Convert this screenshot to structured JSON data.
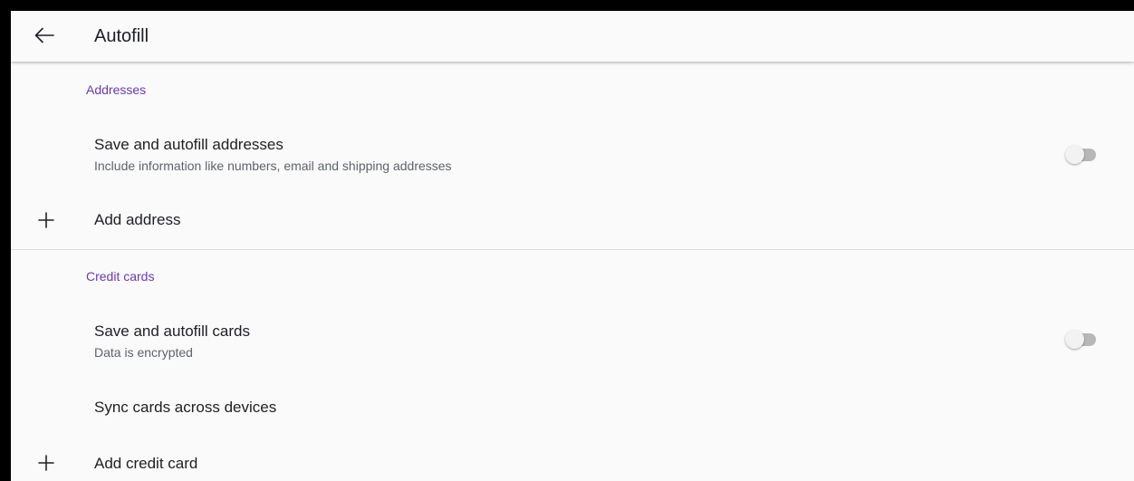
{
  "appbar": {
    "title": "Autofill",
    "back_icon": "arrow-left-icon"
  },
  "addresses": {
    "header": "Addresses",
    "save_title": "Save and autofill addresses",
    "save_subtitle": "Include information like numbers, email and shipping addresses",
    "save_enabled": false,
    "add_label": "Add address",
    "add_icon": "plus-icon"
  },
  "credit_cards": {
    "header": "Credit cards",
    "save_title": "Save and autofill cards",
    "save_subtitle": "Data is encrypted",
    "save_enabled": false,
    "sync_label": "Sync cards across devices",
    "add_label": "Add credit card",
    "add_icon": "plus-icon"
  },
  "colors": {
    "accent": "#673ab7",
    "background": "#fafafa",
    "toggle_off_track": "#b7b7b7",
    "toggle_off_thumb": "#f2f2f2"
  }
}
